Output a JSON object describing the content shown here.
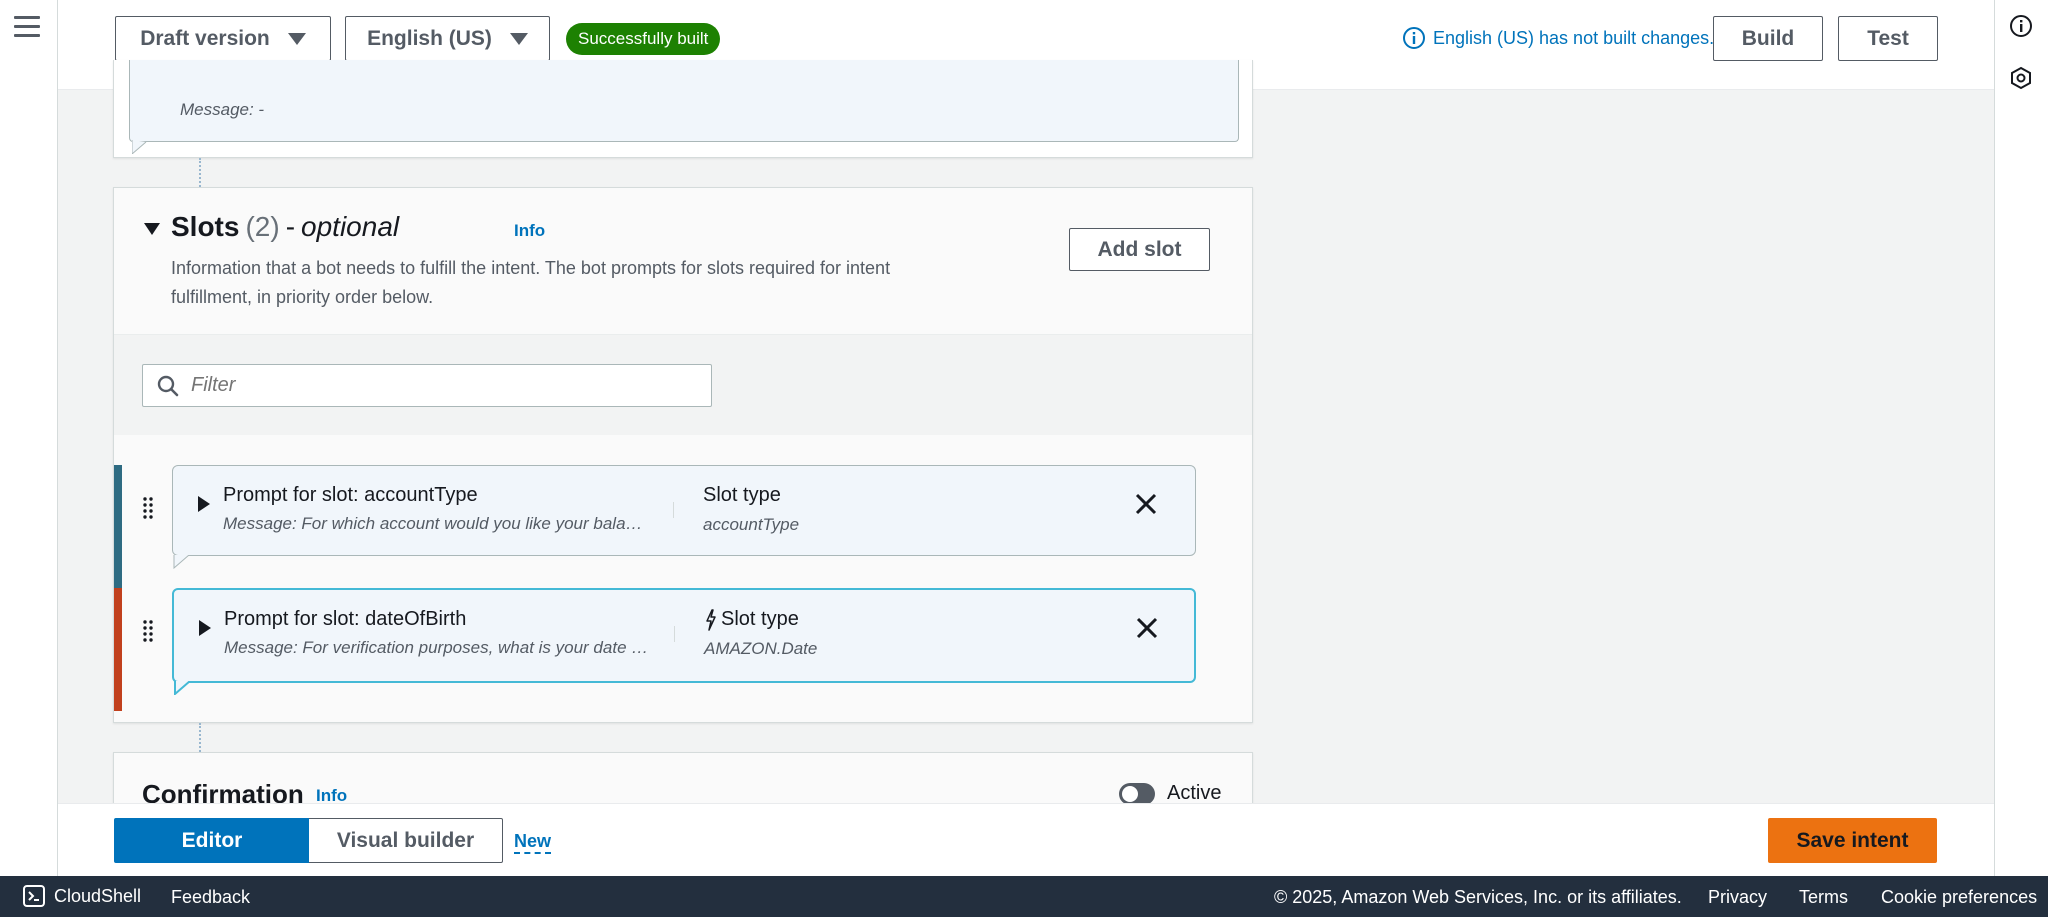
{
  "header": {
    "version_label": "Draft version",
    "language_label": "English (US)",
    "build_status": "Successfully built",
    "build_message": "English (US) has not built changes.",
    "build_button": "Build",
    "test_button": "Test"
  },
  "top_section": {
    "message": "Message: -"
  },
  "slots": {
    "title": "Slots",
    "count": "(2)",
    "dash": "-",
    "optional": "optional",
    "info": "Info",
    "description": "Information that a bot needs to fulfill the intent. The bot prompts for slots required for intent fulfillment, in priority order below.",
    "add_button": "Add slot",
    "filter_placeholder": "Filter",
    "items": [
      {
        "prompt_title": "Prompt for slot: accountType",
        "message": "Message: For which account would you like your balance?",
        "type_label": "Slot type",
        "type_value": "accountType",
        "bar_color": "#2e6b82"
      },
      {
        "prompt_title": "Prompt for slot: dateOfBirth",
        "message": "Message: For verification purposes, what is your date of birth?",
        "type_label": "Slot type",
        "type_value": "AMAZON.Date",
        "bar_color": "#c1401d"
      }
    ]
  },
  "confirmation": {
    "title": "Confirmation",
    "info": "Info",
    "toggle_label": "Active"
  },
  "bottom_bar": {
    "editor_tab": "Editor",
    "visual_tab": "Visual builder",
    "new_label": "New",
    "save_button": "Save intent"
  },
  "footer": {
    "cloudshell": "CloudShell",
    "feedback": "Feedback",
    "copyright": "© 2025, Amazon Web Services, Inc. or its affiliates.",
    "privacy": "Privacy",
    "terms": "Terms",
    "cookies": "Cookie preferences"
  },
  "colors": {
    "accent_blue": "#0073bb",
    "success_green": "#1d8102",
    "save_orange": "#ec7211",
    "footer_bg": "#232f3e",
    "selected_border": "#44b9d6"
  }
}
